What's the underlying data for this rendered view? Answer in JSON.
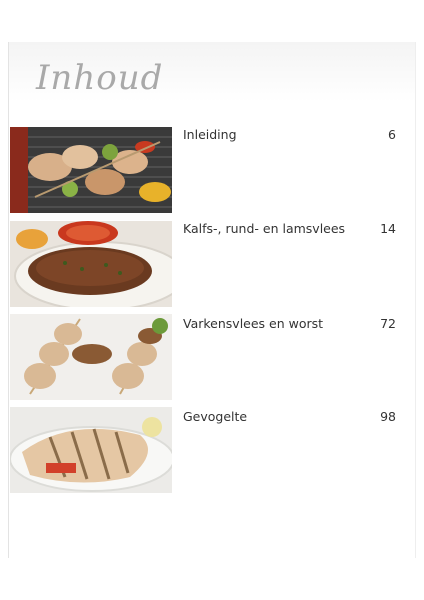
{
  "title": "Inhoud",
  "entries": [
    {
      "label": "Inleiding",
      "page": "6"
    },
    {
      "label": "Kalfs-, rund- en lamsvlees",
      "page": "14"
    },
    {
      "label": "Varkensvlees en worst",
      "page": "72"
    },
    {
      "label": "Gevogelte",
      "page": "98"
    }
  ]
}
